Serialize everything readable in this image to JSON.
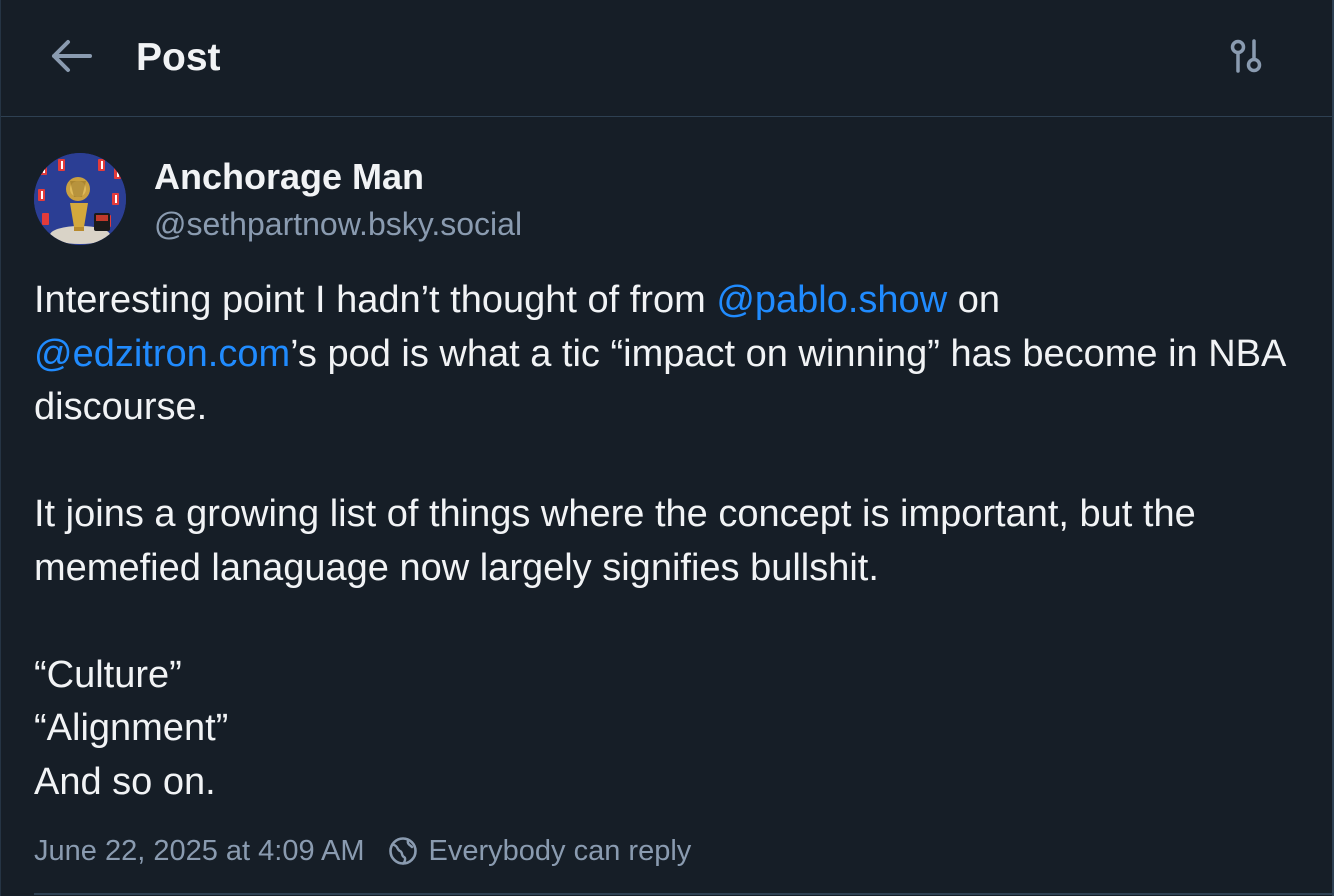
{
  "header": {
    "title": "Post",
    "back_icon": "arrow-left-icon",
    "settings_icon": "sliders-icon"
  },
  "post": {
    "author": {
      "display_name": "Anchorage Man",
      "handle": "@sethpartnow.bsky.social",
      "avatar_icon": "avatar-trophy-image"
    },
    "body": {
      "p1_a": "Interesting point I hadn’t thought of from ",
      "mention_1": "@pablo.show",
      "p1_b": " on ",
      "mention_2": "@edzitron.com",
      "p1_c": "’s pod is what a tic “impact on winning” has become in NBA discourse.",
      "p2": "It joins a growing list of things where the concept is important, but the memefied lanaguage now largely signifies bullshit.",
      "line_1": "“Culture”",
      "line_2": "“Alignment”",
      "line_3": "And so on."
    },
    "timestamp": "June 22, 2025 at 4:09 AM",
    "reply_setting": "Everybody can reply"
  },
  "colors": {
    "background": "#161e27",
    "mention": "#208bfe",
    "muted": "#8a9bb0",
    "divider": "#2e4052"
  }
}
